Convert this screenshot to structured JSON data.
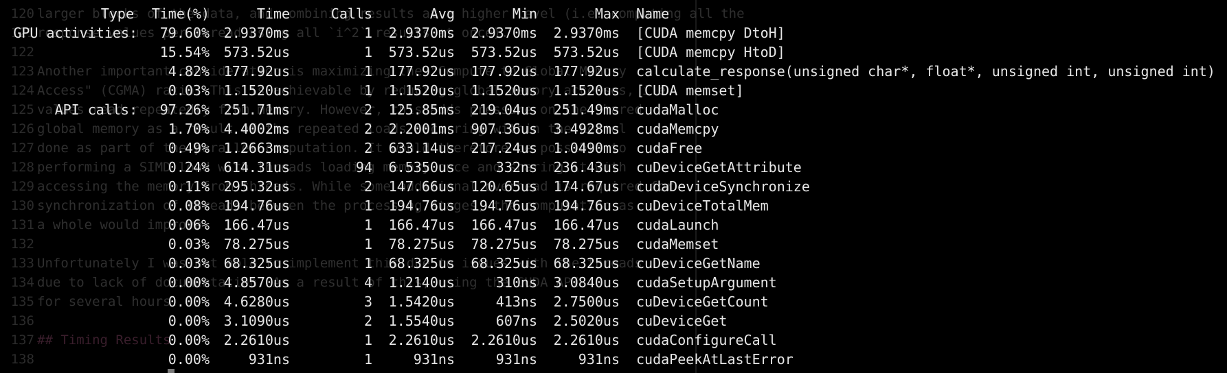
{
  "background_lines": [
    {
      "num": "120",
      "text": "larger blocks of the data, and combining results at a higher level (i.e. computing all the",
      "heading": false
    },
    {
      "num": "121",
      "text": "response values per thread using all `i^2` results at once).",
      "heading": false
    },
    {
      "num": "122",
      "text": "",
      "heading": false
    },
    {
      "num": "123",
      "text": "Another important consideration is maximizing the \"Compute to Global Memory",
      "heading": false
    },
    {
      "num": "124",
      "text": "Access\" (CGMA) ratio. This is achievable by reducing global memory accesses, i.e.",
      "heading": false
    },
    {
      "num": "125",
      "text": "values read repeatedly from memory. However, this adds pressure on the shared",
      "heading": false
    },
    {
      "num": "126",
      "text": "global memory as a result of the repeated loads occurring within the kernel",
      "heading": false
    },
    {
      "num": "127",
      "text": "done as part of the parallel computation. It would therefore be possible to",
      "heading": false
    },
    {
      "num": "128",
      "text": "performing a SIMD load with threads loading memory once and sharing it with",
      "heading": false
    },
    {
      "num": "129",
      "text": "accessing the memory from threads. While some additional overhead is required for",
      "heading": false
    },
    {
      "num": "130",
      "text": "synchronization of threads between the processing stages, the computation as",
      "heading": false
    },
    {
      "num": "131",
      "text": "a whole would improve.",
      "heading": false
    },
    {
      "num": "132",
      "text": "",
      "heading": false
    },
    {
      "num": "133",
      "text": "Unfortunately I was not able to implement this due to issues with the threads",
      "heading": false
    },
    {
      "num": "134",
      "text": "due to lack of documentation. As a result of this, using the CUDA API",
      "heading": false
    },
    {
      "num": "135",
      "text": "for several hours.",
      "heading": false
    },
    {
      "num": "136",
      "text": "",
      "heading": false
    },
    {
      "num": "137",
      "text": "## Timing Results",
      "heading": true
    },
    {
      "num": "138",
      "text": "",
      "heading": false
    }
  ],
  "profiler": {
    "headers": {
      "type": "Type",
      "time_pct": "Time(%)",
      "time": "Time",
      "calls": "Calls",
      "avg": "Avg",
      "min": "Min",
      "max": "Max",
      "name": "Name"
    },
    "rows": [
      {
        "type": "GPU activities:",
        "time_pct": "79.60%",
        "time": "2.9370ms",
        "calls": "1",
        "avg": "2.9370ms",
        "min": "2.9370ms",
        "max": "2.9370ms",
        "name": "[CUDA memcpy DtoH]"
      },
      {
        "type": "",
        "time_pct": "15.54%",
        "time": "573.52us",
        "calls": "1",
        "avg": "573.52us",
        "min": "573.52us",
        "max": "573.52us",
        "name": "[CUDA memcpy HtoD]"
      },
      {
        "type": "",
        "time_pct": "4.82%",
        "time": "177.92us",
        "calls": "1",
        "avg": "177.92us",
        "min": "177.92us",
        "max": "177.92us",
        "name": "calculate_response(unsigned char*, float*, unsigned int, unsigned int)"
      },
      {
        "type": "",
        "time_pct": "0.03%",
        "time": "1.1520us",
        "calls": "1",
        "avg": "1.1520us",
        "min": "1.1520us",
        "max": "1.1520us",
        "name": "[CUDA memset]"
      },
      {
        "type": "API calls:",
        "time_pct": "97.26%",
        "time": "251.71ms",
        "calls": "2",
        "avg": "125.85ms",
        "min": "219.04us",
        "max": "251.49ms",
        "name": "cudaMalloc"
      },
      {
        "type": "",
        "time_pct": "1.70%",
        "time": "4.4002ms",
        "calls": "2",
        "avg": "2.2001ms",
        "min": "907.36us",
        "max": "3.4928ms",
        "name": "cudaMemcpy"
      },
      {
        "type": "",
        "time_pct": "0.49%",
        "time": "1.2663ms",
        "calls": "2",
        "avg": "633.14us",
        "min": "217.24us",
        "max": "1.0490ms",
        "name": "cudaFree"
      },
      {
        "type": "",
        "time_pct": "0.24%",
        "time": "614.31us",
        "calls": "94",
        "avg": "6.5350us",
        "min": "332ns",
        "max": "236.43us",
        "name": "cuDeviceGetAttribute"
      },
      {
        "type": "",
        "time_pct": "0.11%",
        "time": "295.32us",
        "calls": "2",
        "avg": "147.66us",
        "min": "120.65us",
        "max": "174.67us",
        "name": "cudaDeviceSynchronize"
      },
      {
        "type": "",
        "time_pct": "0.08%",
        "time": "194.76us",
        "calls": "1",
        "avg": "194.76us",
        "min": "194.76us",
        "max": "194.76us",
        "name": "cuDeviceTotalMem"
      },
      {
        "type": "",
        "time_pct": "0.06%",
        "time": "166.47us",
        "calls": "1",
        "avg": "166.47us",
        "min": "166.47us",
        "max": "166.47us",
        "name": "cudaLaunch"
      },
      {
        "type": "",
        "time_pct": "0.03%",
        "time": "78.275us",
        "calls": "1",
        "avg": "78.275us",
        "min": "78.275us",
        "max": "78.275us",
        "name": "cudaMemset"
      },
      {
        "type": "",
        "time_pct": "0.03%",
        "time": "68.325us",
        "calls": "1",
        "avg": "68.325us",
        "min": "68.325us",
        "max": "68.325us",
        "name": "cuDeviceGetName"
      },
      {
        "type": "",
        "time_pct": "0.00%",
        "time": "4.8570us",
        "calls": "4",
        "avg": "1.2140us",
        "min": "310ns",
        "max": "3.0840us",
        "name": "cudaSetupArgument"
      },
      {
        "type": "",
        "time_pct": "0.00%",
        "time": "4.6280us",
        "calls": "3",
        "avg": "1.5420us",
        "min": "413ns",
        "max": "2.7500us",
        "name": "cuDeviceGetCount"
      },
      {
        "type": "",
        "time_pct": "0.00%",
        "time": "3.1090us",
        "calls": "2",
        "avg": "1.5540us",
        "min": "607ns",
        "max": "2.5020us",
        "name": "cuDeviceGet"
      },
      {
        "type": "",
        "time_pct": "0.00%",
        "time": "2.2610us",
        "calls": "1",
        "avg": "2.2610us",
        "min": "2.2610us",
        "max": "2.2610us",
        "name": "cudaConfigureCall"
      },
      {
        "type": "",
        "time_pct": "0.00%",
        "time": "931ns",
        "calls": "1",
        "avg": "931ns",
        "min": "931ns",
        "max": "931ns",
        "name": "cudaPeekAtLastError"
      }
    ]
  }
}
